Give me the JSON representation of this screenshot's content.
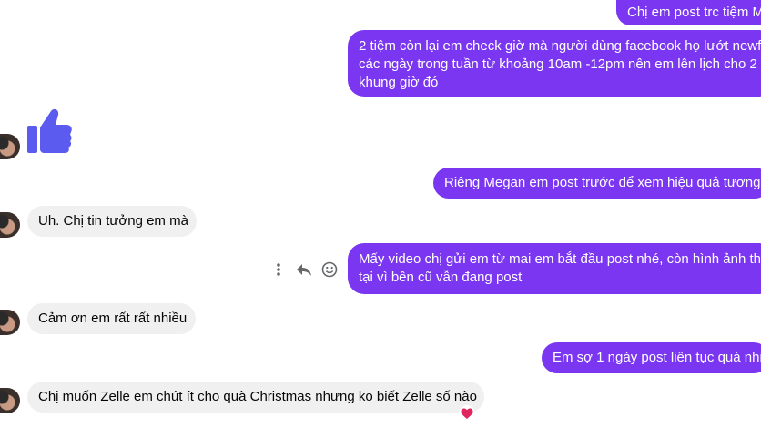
{
  "conversation": {
    "messages": [
      {
        "direction": "outgoing",
        "text": "Chị em post trc tiệm M"
      },
      {
        "direction": "outgoing",
        "lines": [
          "2 tiệm còn lại em check giờ mà người dùng facebook họ lướt newf",
          "các ngày trong tuần từ khoảng 10am -12pm nên em lên lịch cho 2",
          "khung giờ đó"
        ]
      },
      {
        "direction": "outgoing",
        "type": "like-sticker"
      },
      {
        "direction": "outgoing",
        "text": "Riêng Megan em post trước để xem hiệu quả tương"
      },
      {
        "direction": "incoming",
        "text": "Uh. Chị tin tưởng em mà"
      },
      {
        "direction": "outgoing",
        "lines": [
          "Mấy video chị gửi em từ mai em bắt đầu post nhé, còn hình ảnh th",
          "tại vì bên cũ vẫn đang post"
        ]
      },
      {
        "direction": "incoming",
        "text": "Cảm ơn em rất rất nhiều"
      },
      {
        "direction": "outgoing",
        "text": "Em sợ 1 ngày post liên tục quá nhi"
      },
      {
        "direction": "incoming",
        "text": "Chị muốn Zelle em chút ít cho quà Christmas nhưng ko biết Zelle số nào",
        "reaction": "heart"
      }
    ]
  },
  "message_actions": [
    "more-options-icon",
    "reply-icon",
    "emoji-react-icon"
  ],
  "colors": {
    "outgoing_bubble": "#7a36f0",
    "incoming_bubble": "#f0f0f0",
    "like": "#5b5bf0",
    "heart": "#e0245e"
  }
}
